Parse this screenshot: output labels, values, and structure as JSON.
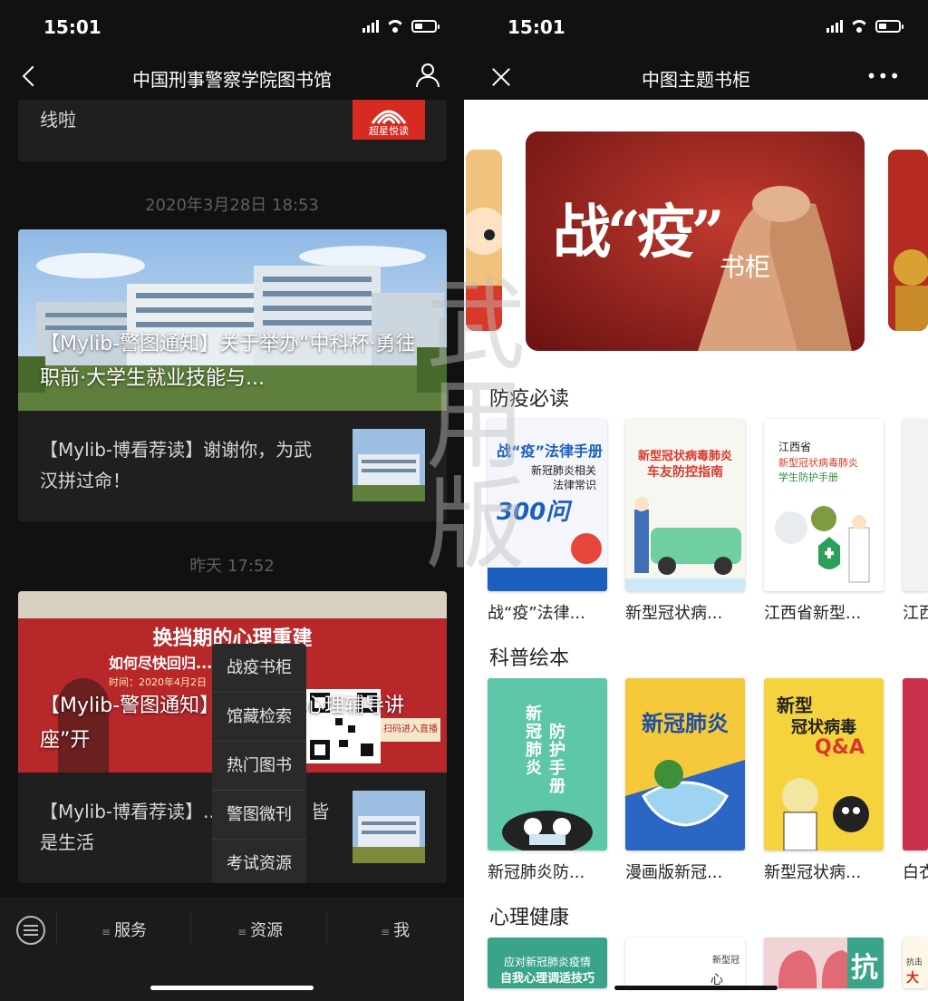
{
  "left": {
    "status": {
      "time": "15:01"
    },
    "nav": {
      "title": "中国刑事警察学院图书馆"
    },
    "top_card": {
      "text": "线啦",
      "badge": "超星悦读"
    },
    "messages": [
      {
        "timestamp": "2020年3月28日 18:53",
        "headline": "【Mylib-警图通知】关于举办“中科杯·勇往职前·大学生就业技能与...",
        "sub": "【Mylib-博看荐读】谢谢你，为武汉拼过命！"
      },
      {
        "timestamp": "昨天 17:52",
        "poster_title": "换挡期的心理重建",
        "poster_sub": "如何尽快回归...状态",
        "poster_time": "时间：2020年4月2日（本周四下...",
        "poster_btn": "扫码进入直播",
        "headline": "【Mylib-警图通知】...大学堂·心理辅导讲座”开",
        "sub": "【Mylib-博看荐读】...万般滋味，皆是生活"
      }
    ],
    "popup_menu": [
      "战疫书柜",
      "馆藏检索",
      "热门图书",
      "警图微刊",
      "考试资源"
    ],
    "tabbar": {
      "tabs": [
        "服务",
        "资源",
        "我"
      ]
    }
  },
  "right": {
    "status": {
      "time": "15:01"
    },
    "nav": {
      "title": "中图主题书柜",
      "more": "•••"
    },
    "banner": {
      "text": "战“疫”",
      "suffix": "书柜"
    },
    "sections": [
      {
        "title": "防疫必读",
        "books": [
          {
            "title": "战“疫”法律...",
            "cover_lines": [
              "战“疫”法律手册",
              "新冠肺炎相关",
              "法律常识",
              "300问"
            ],
            "bg": "#f4f6fb",
            "accent": "#1d5fbf"
          },
          {
            "title": "新型冠状病...",
            "cover_lines": [
              "新型冠状病毒肺炎",
              "车友防控指南"
            ],
            "bg": "#f7f7f2",
            "accent": "#d8392b"
          },
          {
            "title": "江西省新型...",
            "cover_lines": [
              "江西省",
              "新型冠状病毒肺炎",
              "学生防护手册"
            ],
            "bg": "#ffffff",
            "accent": "#d8392b"
          },
          {
            "title": "江西",
            "cover_lines": [],
            "bg": "#f2f2f2",
            "accent": "#d8392b"
          }
        ]
      },
      {
        "title": "科普绘本",
        "books": [
          {
            "title": "新冠肺炎防...",
            "cover_lines": [
              "新冠肺炎",
              "防护手册"
            ],
            "bg": "#5ec6a9",
            "accent": "#ffffff"
          },
          {
            "title": "漫画版新冠...",
            "cover_lines": [
              "新冠肺炎"
            ],
            "bg": "#f6c93a",
            "accent": "#1e4fa0"
          },
          {
            "title": "新型冠状病...",
            "cover_lines": [
              "新型",
              "冠状病毒",
              "Q&A"
            ],
            "bg": "#f5d33f",
            "accent": "#d8392b"
          },
          {
            "title": "白衣",
            "cover_lines": [],
            "bg": "#c9314a",
            "accent": "#ffffff"
          }
        ]
      },
      {
        "title": "心理健康",
        "books": [
          {
            "title": "",
            "cover_lines": [
              "应对新冠肺炎疫情",
              "自我心理调适技巧"
            ],
            "bg": "#3aa48a",
            "accent": "#ffffff"
          },
          {
            "title": "",
            "cover_lines": [
              "新型冠",
              "心"
            ],
            "bg": "#ffffff",
            "accent": "#333333"
          },
          {
            "title": "",
            "cover_lines": [
              "抗"
            ],
            "bg": "#f2d3d5",
            "accent": "#333333"
          },
          {
            "title": "",
            "cover_lines": [
              "抗击",
              "大"
            ],
            "bg": "#fff7e8",
            "accent": "#c7271f"
          }
        ]
      }
    ],
    "watermark": "武用版"
  },
  "colors": {
    "dark_bg": "#111111",
    "card_bg": "#1f1f1f",
    "accent_red": "#d52b21"
  }
}
